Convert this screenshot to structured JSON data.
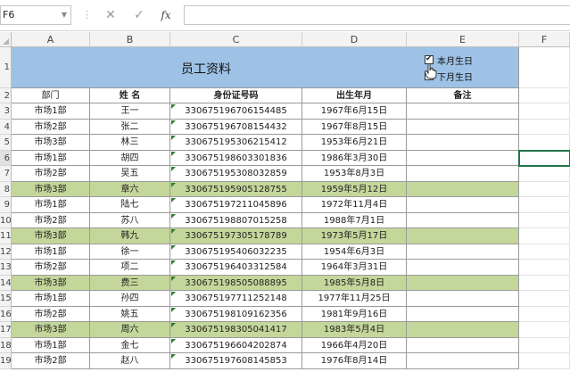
{
  "formula_bar": {
    "name_box": "F6",
    "cancel_icon": "✕",
    "enter_icon": "✓",
    "fx_label": "fx",
    "formula": ""
  },
  "columns": [
    "A",
    "B",
    "C",
    "D",
    "E",
    "F"
  ],
  "title": "员工资料",
  "checkboxes": [
    {
      "label": "本月生日",
      "checked": true
    },
    {
      "label": "下月生日",
      "checked": false
    }
  ],
  "headers": [
    "部门",
    "姓  名",
    "身份证号码",
    "出生年月",
    "备注"
  ],
  "rows": [
    {
      "row": "3",
      "dept": "市场1部",
      "name": "王一",
      "id": "330675196706154485",
      "birth": "1967年6月15日",
      "note": "",
      "highlight": false
    },
    {
      "row": "4",
      "dept": "市场2部",
      "name": "张二",
      "id": "330675196708154432",
      "birth": "1967年8月15日",
      "note": "",
      "highlight": false
    },
    {
      "row": "5",
      "dept": "市场3部",
      "name": "林三",
      "id": "330675195306215412",
      "birth": "1953年6月21日",
      "note": "",
      "highlight": false
    },
    {
      "row": "6",
      "dept": "市场1部",
      "name": "胡四",
      "id": "330675198603301836",
      "birth": "1986年3月30日",
      "note": "",
      "highlight": false
    },
    {
      "row": "7",
      "dept": "市场2部",
      "name": "吴五",
      "id": "330675195308032859",
      "birth": "1953年8月3日",
      "note": "",
      "highlight": false
    },
    {
      "row": "8",
      "dept": "市场3部",
      "name": "章六",
      "id": "330675195905128755",
      "birth": "1959年5月12日",
      "note": "",
      "highlight": true
    },
    {
      "row": "9",
      "dept": "市场1部",
      "name": "陆七",
      "id": "330675197211045896",
      "birth": "1972年11月4日",
      "note": "",
      "highlight": false
    },
    {
      "row": "10",
      "dept": "市场2部",
      "name": "苏八",
      "id": "330675198807015258",
      "birth": "1988年7月1日",
      "note": "",
      "highlight": false
    },
    {
      "row": "11",
      "dept": "市场3部",
      "name": "韩九",
      "id": "330675197305178789",
      "birth": "1973年5月17日",
      "note": "",
      "highlight": true
    },
    {
      "row": "12",
      "dept": "市场1部",
      "name": "徐一",
      "id": "330675195406032235",
      "birth": "1954年6月3日",
      "note": "",
      "highlight": false
    },
    {
      "row": "13",
      "dept": "市场2部",
      "name": "项二",
      "id": "330675196403312584",
      "birth": "1964年3月31日",
      "note": "",
      "highlight": false
    },
    {
      "row": "14",
      "dept": "市场3部",
      "name": "费三",
      "id": "330675198505088895",
      "birth": "1985年5月8日",
      "note": "",
      "highlight": true
    },
    {
      "row": "15",
      "dept": "市场1部",
      "name": "孙四",
      "id": "330675197711252148",
      "birth": "1977年11月25日",
      "note": "",
      "highlight": false
    },
    {
      "row": "16",
      "dept": "市场2部",
      "name": "姚五",
      "id": "330675198109162356",
      "birth": "1981年9月16日",
      "note": "",
      "highlight": false
    },
    {
      "row": "17",
      "dept": "市场3部",
      "name": "周六",
      "id": "330675198305041417",
      "birth": "1983年5月4日",
      "note": "",
      "highlight": true
    },
    {
      "row": "18",
      "dept": "市场1部",
      "name": "金七",
      "id": "330675196604202874",
      "birth": "1966年4月20日",
      "note": "",
      "highlight": false
    },
    {
      "row": "19",
      "dept": "市场2部",
      "name": "赵八",
      "id": "330675197608145853",
      "birth": "1976年8月14日",
      "note": "",
      "highlight": false
    }
  ],
  "header_row_label": "2",
  "title_row_label": "1",
  "colors": {
    "title_fill": "#9ec2e6",
    "highlight_fill": "#c4d79b",
    "selection": "#217346",
    "header_fill": "#f3f3f3"
  }
}
